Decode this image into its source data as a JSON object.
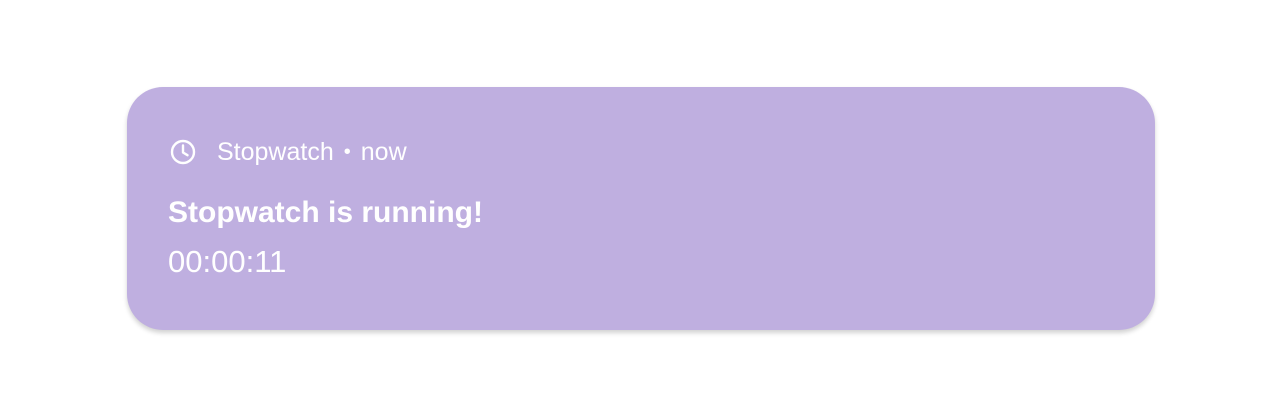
{
  "notification": {
    "app_icon": "clock-icon",
    "app_name": "Stopwatch",
    "separator": "•",
    "time": "now",
    "title": "Stopwatch is running!",
    "body": "00:00:11",
    "colors": {
      "background": "#bfafe0",
      "text": "#ffffff"
    }
  }
}
